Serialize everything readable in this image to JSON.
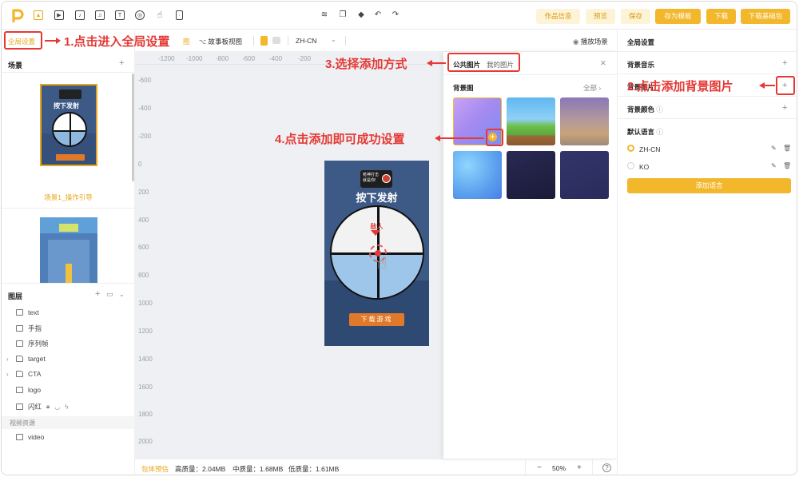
{
  "toolbar": {
    "tools": [
      {
        "name": "P",
        "icon": "logo-icon"
      },
      {
        "icon": "image-tool-icon"
      },
      {
        "icon": "video-tool-icon"
      },
      {
        "icon": "audio-tool-icon"
      },
      {
        "icon": "music-tool-icon"
      },
      {
        "icon": "text-tool-icon"
      },
      {
        "icon": "target-tool-icon"
      },
      {
        "icon": "gesture-tool-icon"
      },
      {
        "icon": "phone-tool-icon"
      }
    ],
    "buttons": {
      "info": "作品信息",
      "preview": "预览",
      "save": "保存",
      "save_template": "存为模板",
      "download": "下载",
      "download_base": "下载基础包"
    }
  },
  "left": {
    "global_settings": "全局设置",
    "scene_title": "场景",
    "scene_label": "场景1_操作引导",
    "layers_title": "图层",
    "layers": [
      {
        "label": "text",
        "icon": "text-layer-icon"
      },
      {
        "label": "手指",
        "icon": "image-layer-icon"
      },
      {
        "label": "序列帧",
        "icon": "sequence-layer-icon"
      },
      {
        "label": "target",
        "icon": "folder-icon",
        "group": true
      },
      {
        "label": "CTA",
        "icon": "folder-icon",
        "group": true
      },
      {
        "label": "logo",
        "icon": "image-layer-icon"
      },
      {
        "label": "闪红",
        "icon": "image-layer-icon"
      }
    ],
    "video_resources": "视频资源",
    "video_item": "video"
  },
  "subbar": {
    "view_label": "图",
    "storyboard": "故事板视图",
    "language": "ZH-CN",
    "play_scene": "播放场景"
  },
  "ruler": {
    "top": [
      "-1200",
      "-1000",
      "-800",
      "-600",
      "-400",
      "-200"
    ],
    "left": [
      "-600",
      "-400",
      "-200",
      "0",
      "200",
      "400",
      "600",
      "800",
      "1000",
      "1200",
      "1400",
      "1600",
      "1800",
      "2000"
    ]
  },
  "status": {
    "package_label": "包体预估",
    "high": "高质量：2.04MB",
    "mid": "中质量：1.68MB",
    "low": "低质量：1.61MB",
    "zoom": "50%",
    "zoom_minus": "−",
    "zoom_plus": "+",
    "help": "?"
  },
  "phone": {
    "logo_text": "枪神打击\n就是你!",
    "headline": "按下发射",
    "enemy": "敌人",
    "cta": "下载游戏"
  },
  "popup": {
    "tab_public": "公共图片",
    "tab_mine": "我的图片",
    "section": "背景图",
    "all": "全部"
  },
  "right": {
    "title": "全局设置",
    "bg_music": "背景音乐",
    "bg_image": "背景图片",
    "bg_color": "背景颜色",
    "default_lang": "默认语言",
    "lang_1": "ZH-CN",
    "lang_2": "KO",
    "add_lang": "添加语言"
  },
  "annotations": {
    "step1": "1.点击进入全局设置",
    "step2": "2.点击添加背景图片",
    "step3": "3.选择添加方式",
    "step4": "4.点击添加即可成功设置"
  },
  "colors": {
    "accent": "#f3b72c",
    "accent_text": "#e8a71a",
    "annotation": "#e53935"
  }
}
